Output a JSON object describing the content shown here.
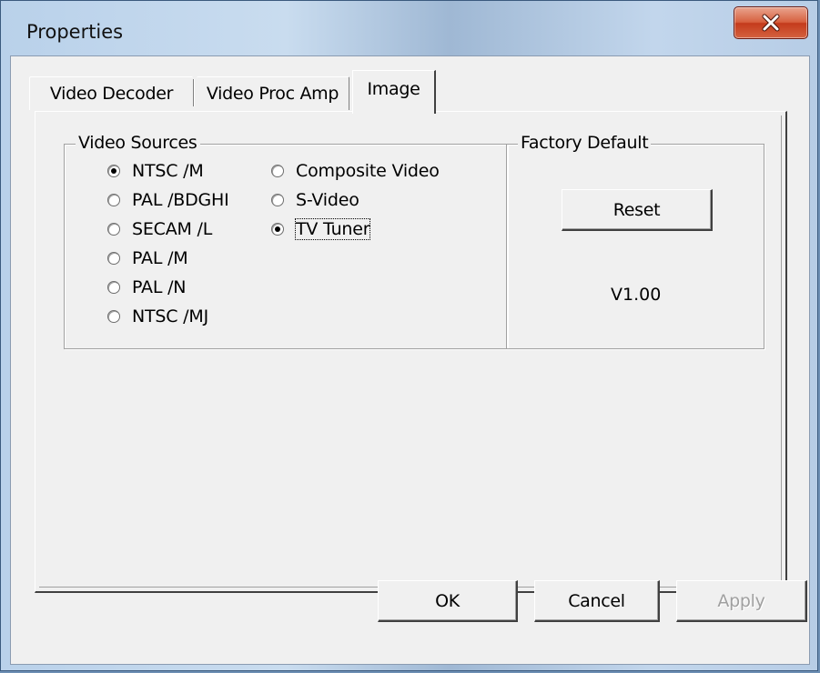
{
  "window": {
    "title": "Properties"
  },
  "tabs": [
    {
      "label": "Video Decoder"
    },
    {
      "label": "Video Proc Amp"
    },
    {
      "label": "Image"
    }
  ],
  "video_sources": {
    "label": "Video Sources",
    "standards": [
      {
        "label": "NTSC /M",
        "checked": true
      },
      {
        "label": "PAL /BDGHI",
        "checked": false
      },
      {
        "label": "SECAM /L",
        "checked": false
      },
      {
        "label": "PAL /M",
        "checked": false
      },
      {
        "label": "PAL /N",
        "checked": false
      },
      {
        "label": "NTSC /MJ",
        "checked": false
      }
    ],
    "inputs": [
      {
        "label": "Composite Video",
        "checked": false
      },
      {
        "label": "S-Video",
        "checked": false
      },
      {
        "label": "TV Tuner",
        "checked": true
      }
    ]
  },
  "factory_default": {
    "label": "Factory Default",
    "reset_label": "Reset",
    "version": "V1.00"
  },
  "buttons": {
    "ok": "OK",
    "cancel": "Cancel",
    "apply": "Apply"
  },
  "colors": {
    "dialog_bg": "#f0f0f0",
    "close_button": "#c8452a",
    "frame": "#b9d1ea"
  }
}
